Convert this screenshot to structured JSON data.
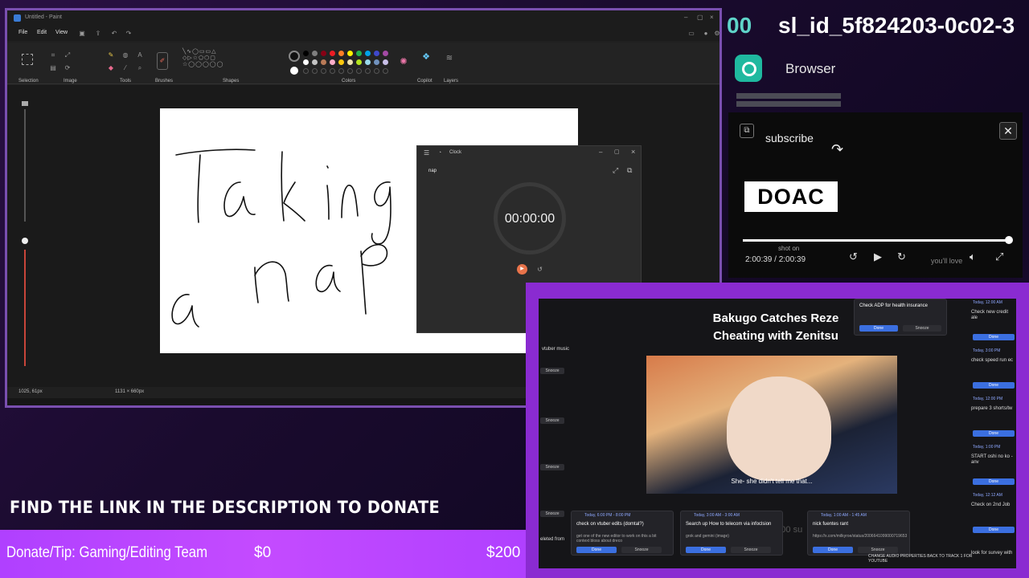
{
  "paint": {
    "window_title": "Untitled - Paint",
    "menu": [
      "File",
      "Edit",
      "View"
    ],
    "ribbon_groups": [
      "Selection",
      "Image",
      "Tools",
      "Brushes",
      "Shapes",
      "Colors",
      "Copilot",
      "Layers"
    ],
    "status_cursor": "1025, 61px",
    "status_size": "1131 × 660px",
    "canvas_text": [
      "Taking",
      "a nap"
    ]
  },
  "clock": {
    "title": "Clock",
    "timer_name": "nap",
    "time": "00:00:00"
  },
  "header": {
    "number": "00",
    "id": "sl_id_5f824203-0c02-3",
    "browser_label": "Browser"
  },
  "video": {
    "subscribe": "subscribe",
    "logo": "DOAC",
    "timecode": "2:00:39 / 2:00:39",
    "overlay_text_1": "shot on",
    "overlay_text_2": "you'll love"
  },
  "stream_panel": {
    "video_title_line1": "Bakugo Catches Reze",
    "video_title_line2": "Cheating with Zenitsu",
    "subtitle": "She- she didn't tell me that...",
    "top_card": "Check ADP for health insurance",
    "left_notes": [
      "vtuber music",
      "Snooze",
      "Snooze",
      "Snooze",
      "Snooze",
      "eleted from"
    ],
    "right_items": [
      {
        "meta": "Today, 12:00 AM",
        "title": "Check new credit ale"
      },
      {
        "meta": "Today, 3:00 PM",
        "title": "check speed run ec"
      },
      {
        "meta": "Today, 12:00 PM",
        "title": "prepare 3 shorts/tw"
      },
      {
        "meta": "Today, 1:00 PM",
        "title": "START oshi no ko - anv"
      },
      {
        "meta": "Today, 12:12 AM",
        "title": "Check on 2nd Job"
      },
      {
        "meta": "",
        "title": "look for survey with"
      }
    ],
    "bottom_cards": [
      {
        "meta": "Today, 6:00 PM - 8:00 PM",
        "title": "check on vtuber edits (domtal?)",
        "sub": "get one of the new editor to work on this a bit context bloss about dreco"
      },
      {
        "meta": "Today, 3:00 AM - 3:00 AM",
        "title": "Search up How to telecom via infoclsion",
        "sub": "grok and gemini (image)"
      },
      {
        "meta": "Today, 1:00 AM - 1:45 AM",
        "title": "nick fuentes rant",
        "sub": "https://x.com/milkyroe/status/2006641099000719653"
      }
    ],
    "bottom_right_note": "CHANGE AUDIO PROPERTIES BACK TO TRACK 1 FOR YOUTUBE",
    "faint_amount": "5,000 su",
    "done": "Done",
    "snooze": "Snooze"
  },
  "donate": {
    "find_link": "FIND THE LINK IN THE DESCRIPTION TO DONATE",
    "label": "Donate/Tip: Gaming/Editing Team",
    "current": "$0",
    "goal": "$200",
    "progress_fraction": 0
  },
  "colors": {
    "accent_purple": "#b040ff",
    "teal": "#5fd4c9",
    "done_blue": "#3b6fe0",
    "play_orange": "#e8734a"
  }
}
